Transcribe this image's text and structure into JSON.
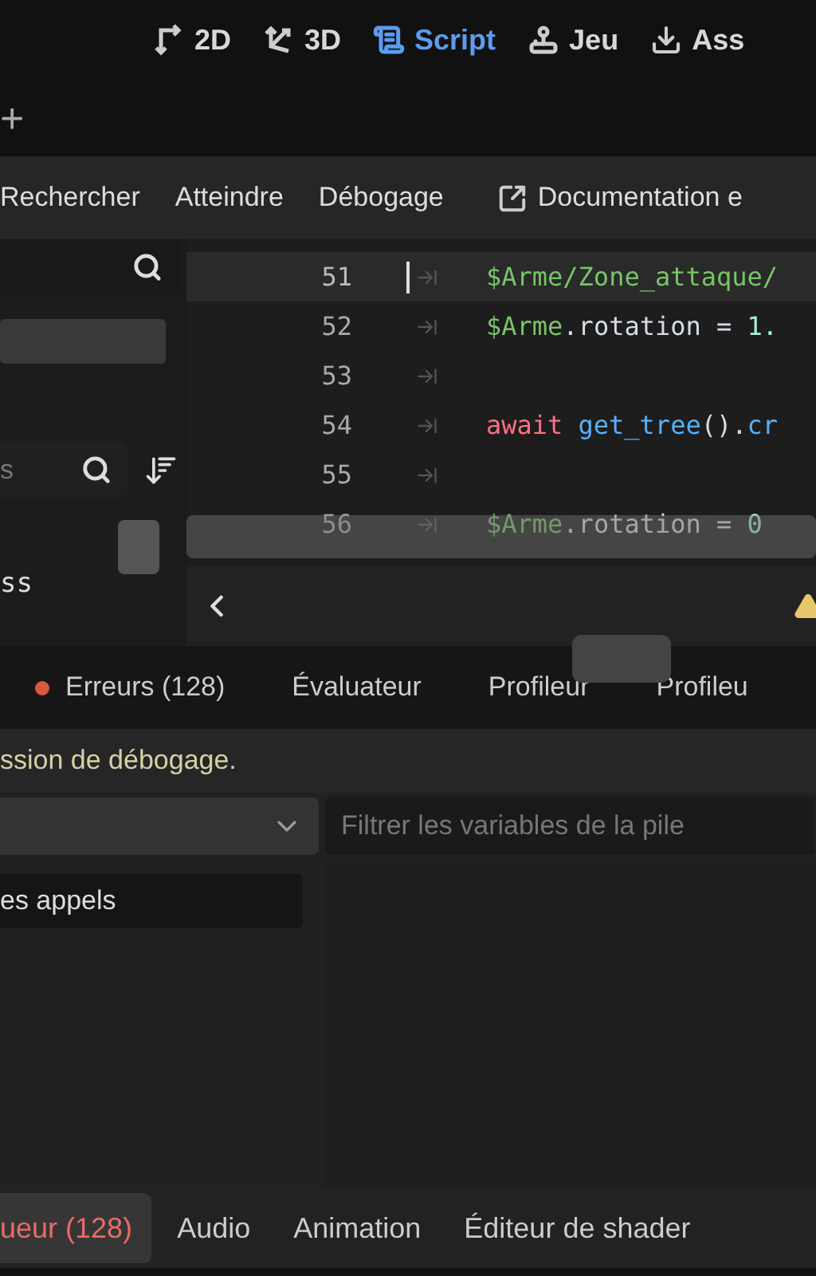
{
  "main_tabs": [
    {
      "label": "2D",
      "selected": false
    },
    {
      "label": "3D",
      "selected": false
    },
    {
      "label": "Script",
      "selected": true
    },
    {
      "label": "Jeu",
      "selected": false
    },
    {
      "label": "Ass",
      "selected": false
    }
  ],
  "add_tab": "+",
  "menu": [
    "Rechercher",
    "Atteindre",
    "Débogage"
  ],
  "doc_link": "Documentation e",
  "script_panel": {
    "filter_placeholder": "s",
    "items": [
      {
        "label": "ss"
      }
    ]
  },
  "code": {
    "lines": [
      {
        "number": "51",
        "current": true,
        "tokens": [
          {
            "text": "$Arme/Zone_attaque/",
            "kind": "node"
          }
        ]
      },
      {
        "number": "52",
        "current": false,
        "tokens": [
          {
            "text": "$Arme",
            "kind": "node"
          },
          {
            "text": ".rotation = ",
            "kind": "plain"
          },
          {
            "text": "1.",
            "kind": "number"
          }
        ]
      },
      {
        "number": "53",
        "current": false
      },
      {
        "number": "54",
        "current": false,
        "tokens": [
          {
            "text": "await",
            "kind": "keyword"
          },
          {
            "text": "get_tree",
            "kind": "function"
          },
          {
            "text": "().",
            "kind": "plain"
          },
          {
            "text": "cr",
            "kind": "function"
          }
        ]
      },
      {
        "number": "55",
        "current": false
      },
      {
        "number": "56",
        "current": false,
        "tokens": [
          {
            "text": "$Arme",
            "kind": "node"
          },
          {
            "text": ".rotation = ",
            "kind": "plain"
          },
          {
            "text": "0",
            "kind": "number"
          }
        ]
      }
    ]
  },
  "debugger_tabs": [
    {
      "label": "Erreurs (128)",
      "selected": false,
      "color": "#d9573f"
    },
    {
      "label": "Évaluateur",
      "selected": false
    },
    {
      "label": "Profileur",
      "selected": false
    },
    {
      "label": "Profileu",
      "selected": false
    }
  ],
  "message": "ssion de débogage.",
  "stack_filter": {
    "placeholder": "Filtrer les variables de la pile"
  },
  "stack_item": "es appels",
  "bottom_tabs": [
    {
      "label": "ueur (128)",
      "selected": true,
      "alert": true
    },
    {
      "label": "Audio",
      "selected": false,
      "alert": false
    },
    {
      "label": "Animation",
      "selected": false,
      "alert": false
    },
    {
      "label": "Éditeur de shader",
      "selected": false,
      "alert": false
    }
  ]
}
